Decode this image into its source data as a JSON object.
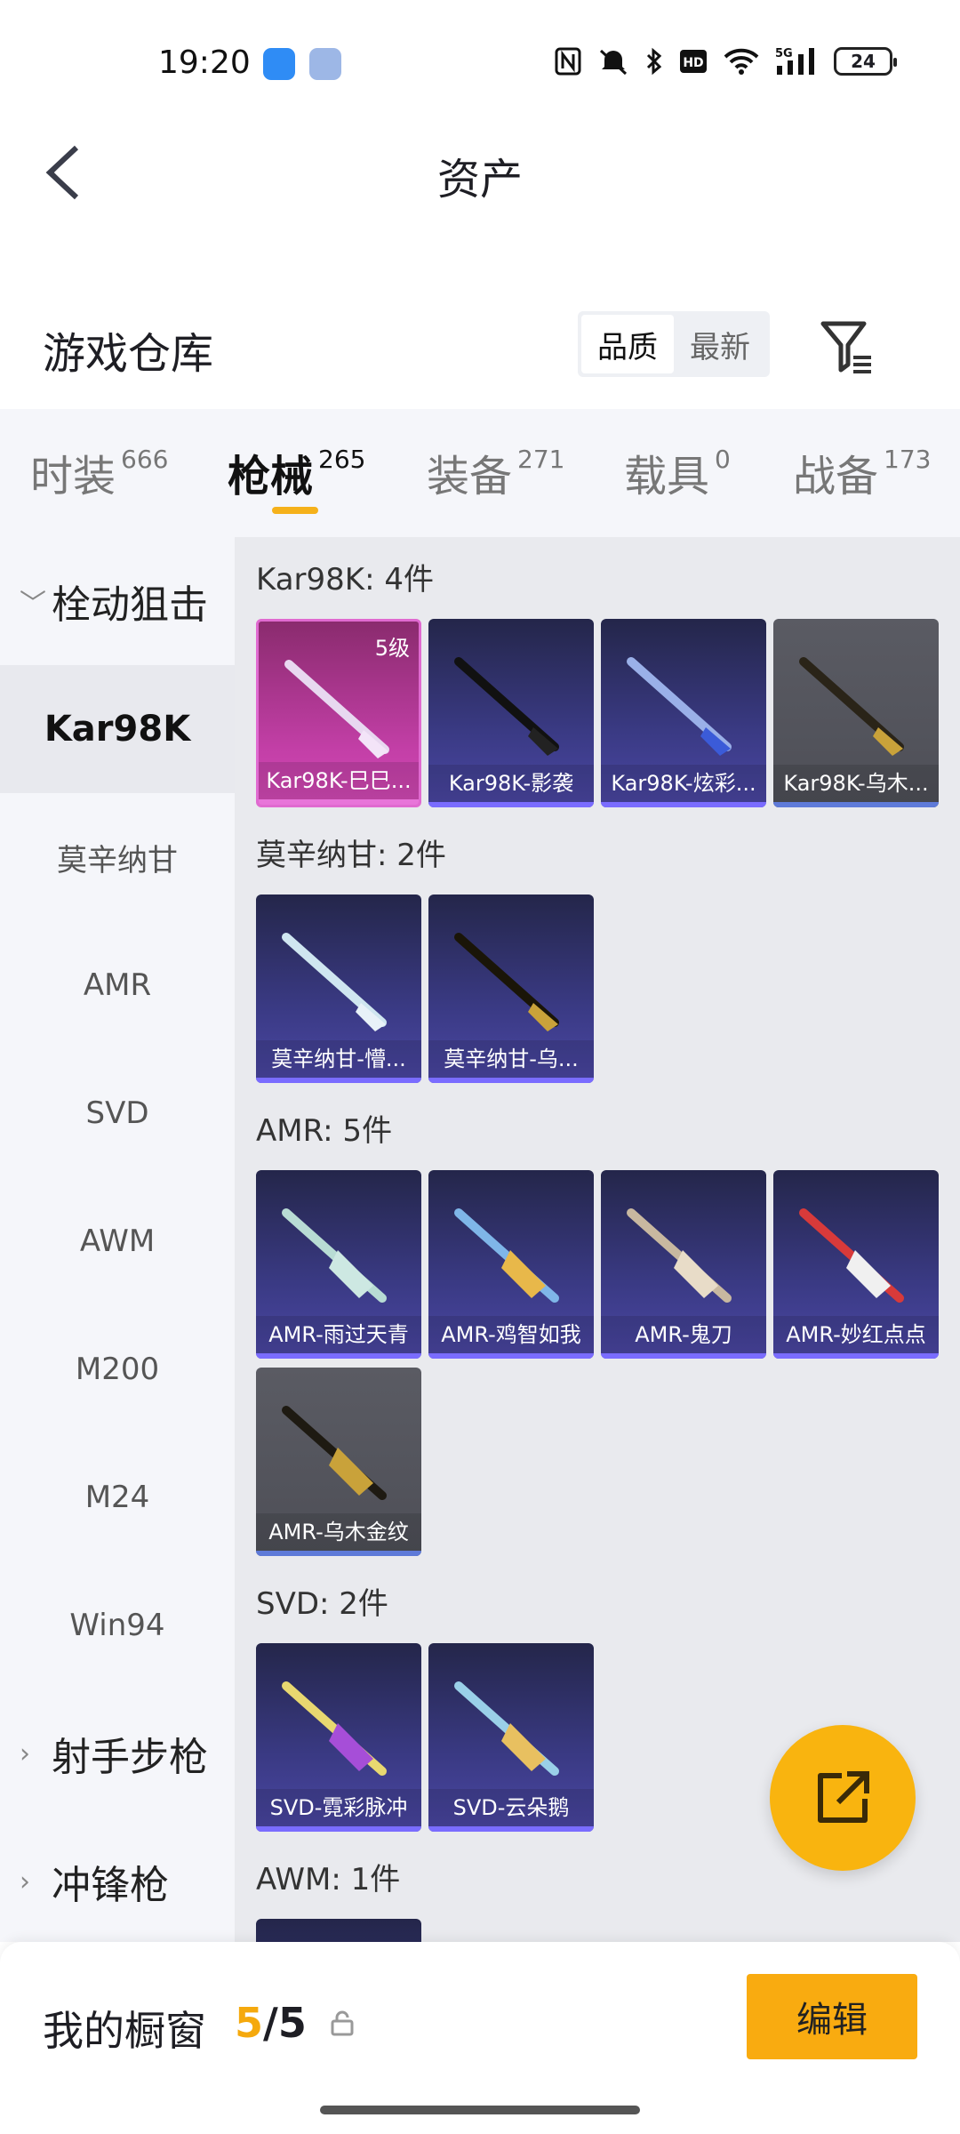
{
  "status_bar": {
    "time": "19:20",
    "battery": "24",
    "icons": [
      "nfc-icon",
      "mute-icon",
      "bluetooth-icon",
      "hd-icon",
      "wifi-icon",
      "signal-5g-icon"
    ]
  },
  "header": {
    "title": "资产"
  },
  "warehouse": {
    "title": "游戏仓库",
    "sort_options": [
      "品质",
      "最新"
    ],
    "active_sort": "品质"
  },
  "tabs": [
    {
      "label": "时装",
      "count": "666"
    },
    {
      "label": "枪械",
      "count": "265",
      "active": true
    },
    {
      "label": "装备",
      "count": "271"
    },
    {
      "label": "载具",
      "count": "0"
    },
    {
      "label": "战备",
      "count": "173"
    }
  ],
  "sidebar": {
    "items": [
      {
        "label": "栓动狙击",
        "type": "group",
        "expanded": true
      },
      {
        "label": "Kar98K",
        "type": "sub",
        "selected": true
      },
      {
        "label": "莫辛纳甘",
        "type": "sub"
      },
      {
        "label": "AMR",
        "type": "sub"
      },
      {
        "label": "SVD",
        "type": "sub"
      },
      {
        "label": "AWM",
        "type": "sub"
      },
      {
        "label": "M200",
        "type": "sub"
      },
      {
        "label": "M24",
        "type": "sub"
      },
      {
        "label": "Win94",
        "type": "sub"
      },
      {
        "label": "射手步枪",
        "type": "group"
      },
      {
        "label": "冲锋枪",
        "type": "group"
      }
    ]
  },
  "sections": [
    {
      "title": "Kar98K: 4件",
      "items": [
        {
          "name": "Kar98K-巳巳...",
          "level": "5级",
          "style": "pink"
        },
        {
          "name": "Kar98K-影袭",
          "style": "purple"
        },
        {
          "name": "Kar98K-炫彩...",
          "style": "purple"
        },
        {
          "name": "Kar98K-乌木...",
          "style": "grey"
        }
      ]
    },
    {
      "title": "莫辛纳甘: 2件",
      "items": [
        {
          "name": "莫辛纳甘-懵...",
          "style": "purple"
        },
        {
          "name": "莫辛纳甘-乌...",
          "style": "purple"
        }
      ]
    },
    {
      "title": "AMR: 5件",
      "items": [
        {
          "name": "AMR-雨过天青",
          "style": "purple"
        },
        {
          "name": "AMR-鸡智如我",
          "style": "purple"
        },
        {
          "name": "AMR-鬼刀",
          "style": "purple"
        },
        {
          "name": "AMR-妙红点点",
          "style": "purple"
        },
        {
          "name": "AMR-乌木金纹",
          "style": "grey"
        }
      ]
    },
    {
      "title": "SVD: 2件",
      "items": [
        {
          "name": "SVD-霓彩脉冲",
          "style": "purple"
        },
        {
          "name": "SVD-云朵鹅",
          "style": "purple"
        }
      ]
    },
    {
      "title": "AWM: 1件",
      "items": [
        {
          "name": "",
          "style": "purple"
        }
      ]
    }
  ],
  "bottom_bar": {
    "title": "我的橱窗",
    "count_current": "5",
    "count_sep": "/",
    "count_total": "5",
    "edit_label": "编辑"
  },
  "colors": {
    "accent": "#f9ab10",
    "tab_indicator": "#f5b11a"
  }
}
